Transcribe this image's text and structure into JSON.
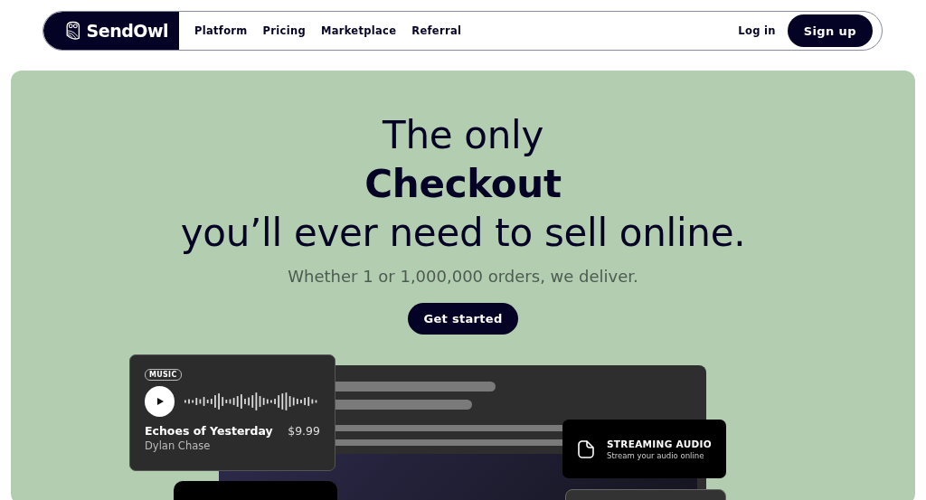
{
  "nav": {
    "brand": "SendOwl",
    "links": [
      "Platform",
      "Pricing",
      "Marketplace",
      "Referral"
    ],
    "login": "Log in",
    "signup": "Sign up"
  },
  "hero": {
    "title_lines": [
      {
        "text": "The only",
        "emphasis": false
      },
      {
        "text": "Checkout",
        "emphasis": true
      },
      {
        "text": "you’ll ever need to sell online.",
        "emphasis": false
      }
    ],
    "subtitle": "Whether 1 or 1,000,000 orders, we deliver.",
    "cta": "Get started"
  },
  "music_card": {
    "tag": "MUSIC",
    "title": "Echoes of Yesterday",
    "artist": "Dylan Chase",
    "price": "$9.99"
  },
  "feature_card": {
    "title": "STREAMING AUDIO",
    "subtitle": "Stream your audio online"
  }
}
